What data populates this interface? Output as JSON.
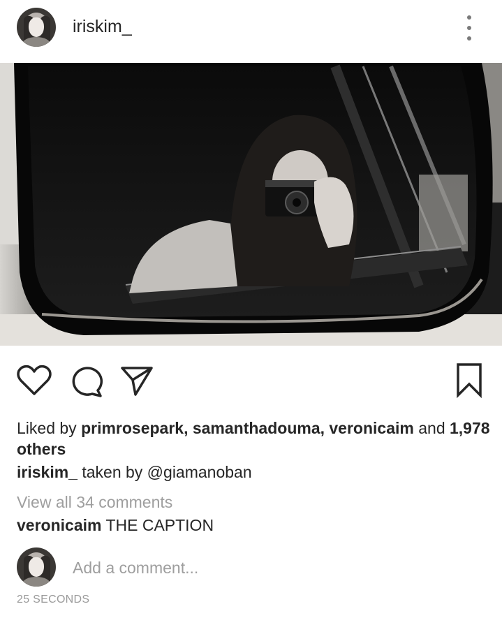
{
  "post": {
    "username": "iriskim_",
    "more_icon": "more-vertical-icon"
  },
  "actions": {
    "like_icon": "heart-icon",
    "comment_icon": "comment-icon",
    "share_icon": "paper-plane-icon",
    "save_icon": "bookmark-icon"
  },
  "likes": {
    "prefix": "Liked by",
    "users": "primrosepark, samanthadouma, veronicaim",
    "connector": "and",
    "count": "1,978 others"
  },
  "caption": {
    "username": "iriskim_",
    "text": "taken by @giamanoban"
  },
  "comments": {
    "view_all": "View all 34 comments",
    "items": [
      {
        "username": "veronicaim",
        "text": "THE CAPTION"
      }
    ]
  },
  "add_comment": {
    "placeholder": "Add a comment..."
  },
  "timestamp": "25 SECONDS"
}
